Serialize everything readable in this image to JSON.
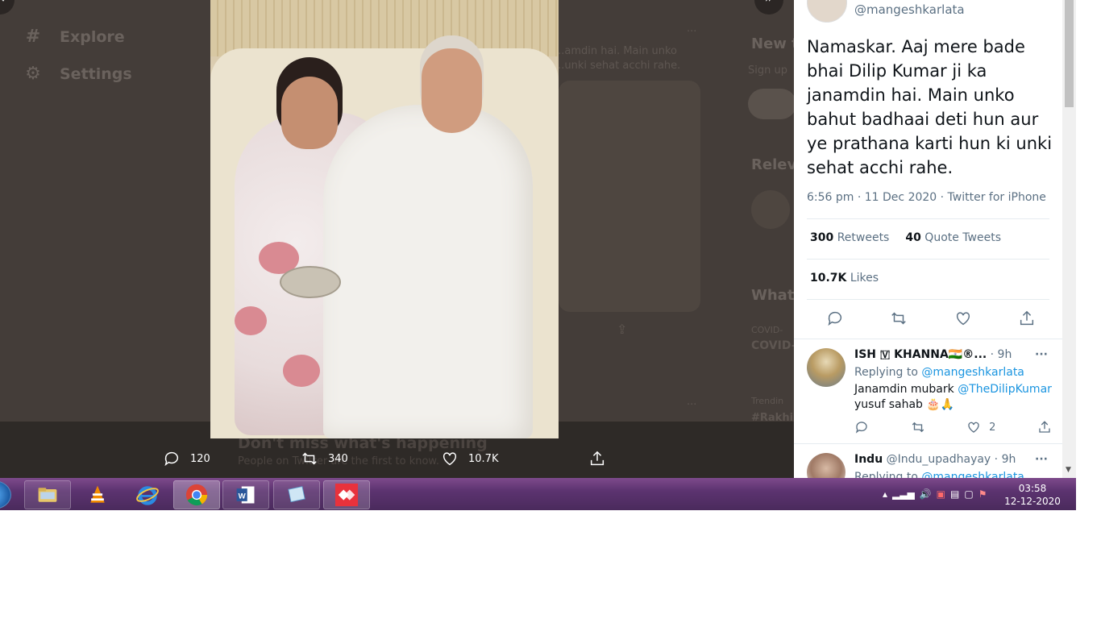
{
  "background": {
    "nav": [
      {
        "label": "Explore",
        "icon": "hashtag-icon"
      },
      {
        "label": "Settings",
        "icon": "gear-icon"
      }
    ],
    "snippet1": "...amdin hai. Main unko",
    "snippet2": "...unki sehat acchi rahe.",
    "new_to": "New t",
    "sign_up": "Sign up",
    "relevant": "Relev",
    "whats": "What'",
    "covid_small": "COVID-",
    "covid_bold": "COVID-",
    "trending": "Trendin",
    "rakhi": "#Rakhi",
    "dont_miss": "Don't miss what's happening",
    "people_on": "People on Twitter are the first to know."
  },
  "image_actions": {
    "replies": "120",
    "retweets": "340",
    "likes": "10.7K"
  },
  "tweet": {
    "handle": "@mangeshkarlata",
    "text": "Namaskar. Aaj mere bade bhai Dilip Kumar ji ka janamdin hai. Main unko bahut badhaai deti hun aur ye prathana karti hun ki unki sehat acchi rahe.",
    "time": "6:56 pm · 11 Dec 2020 · Twitter for iPhone",
    "retweets_count": "300",
    "retweets_label": "Retweets",
    "quotes_count": "40",
    "quotes_label": "Quote Tweets",
    "likes_count": "10.7K",
    "likes_label": "Likes"
  },
  "replies": [
    {
      "name": "ISH 🇻 KHANNA🇮🇳®...",
      "age": "· 9h",
      "replying_prefix": "Replying to",
      "replying_to": "@mangeshkarlata",
      "line1_text": "Janamdin mubark",
      "line1_mention": "@TheDilipKumar",
      "line2": "yusuf sahab 🎂🙏",
      "like_count": "2"
    },
    {
      "name": "Indu",
      "handle": "@Indu_upadhayay",
      "age": "· 9h",
      "replying_prefix": "Replying to",
      "replying_to": "@mangeshkarlata"
    }
  ],
  "taskbar": {
    "apps": [
      "file-explorer",
      "vlc",
      "internet-explorer",
      "chrome",
      "word",
      "snipping-tool",
      "anydesk"
    ],
    "time": "03:58",
    "date": "12-12-2020"
  },
  "colors": {
    "accent": "#1b95e0",
    "overlay": "#443d39",
    "taskbar": "#5c3370"
  }
}
